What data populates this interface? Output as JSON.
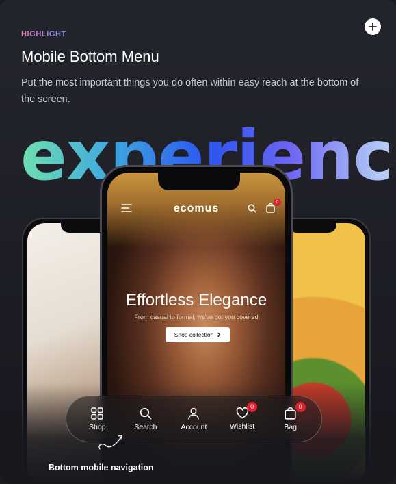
{
  "card": {
    "eyebrow": "HIGHLIGHT",
    "title": "Mobile Bottom Menu",
    "description": "Put the most important things you do often within easy reach at the bottom of the screen.",
    "decor_word": "experience",
    "plus_icon": "plus-icon"
  },
  "phone": {
    "logo": "ecomus",
    "cart_count": "0",
    "hero_title": "Effortless Elegance",
    "hero_subtitle": "From casual to formal, we've got you covered",
    "hero_button": "Shop collection",
    "hero_button_icon": "chevron-right-icon"
  },
  "bottom_nav": {
    "items": [
      {
        "label": "Shop",
        "icon": "grid-icon"
      },
      {
        "label": "Search",
        "icon": "search-icon"
      },
      {
        "label": "Account",
        "icon": "user-icon"
      },
      {
        "label": "Wishlist",
        "icon": "heart-icon",
        "badge": "0"
      },
      {
        "label": "Bag",
        "icon": "bag-icon",
        "badge": "0"
      }
    ]
  },
  "caption": "Bottom mobile navigation",
  "colors": {
    "badge": "#e0212f",
    "card_bg": "#1f2028",
    "accent_pink": "#ee7ab4",
    "accent_blue": "#2b55f0"
  }
}
